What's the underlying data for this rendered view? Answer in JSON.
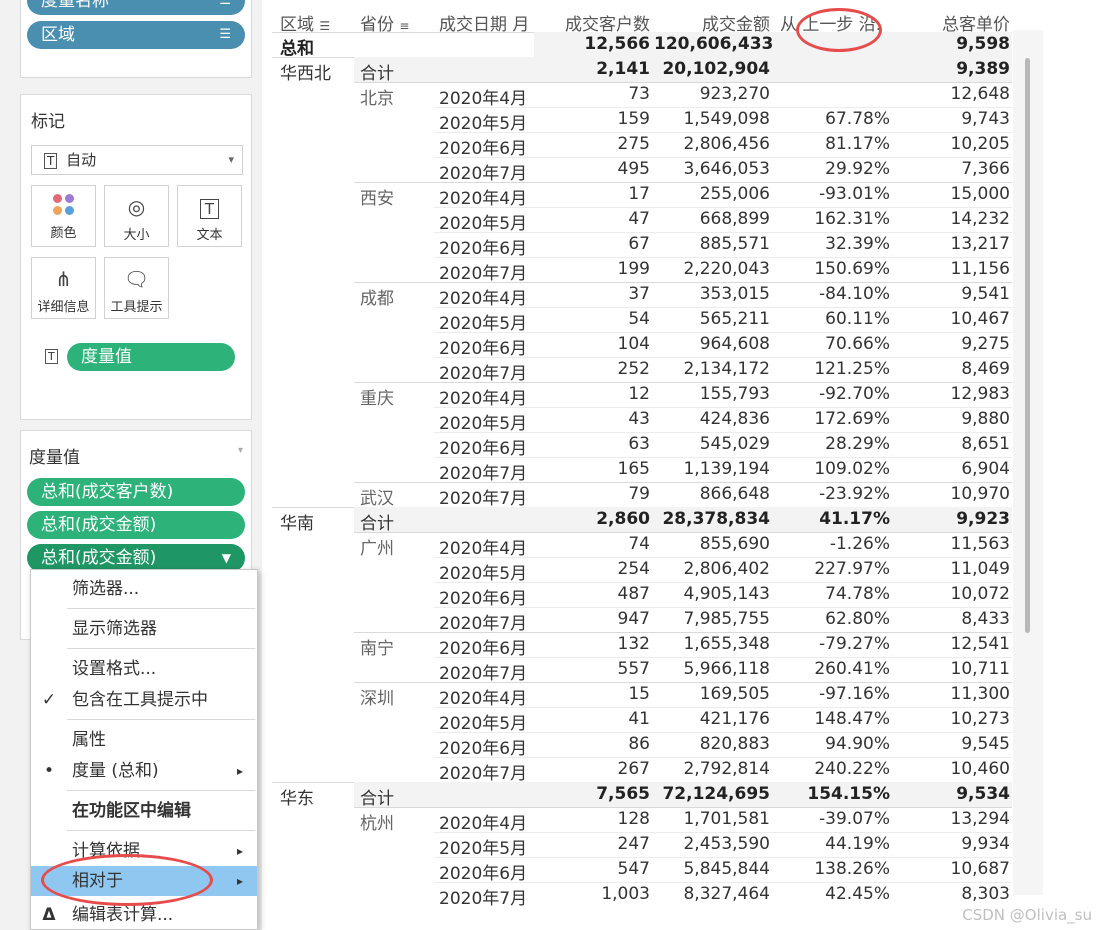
{
  "shelf_pills": {
    "pill1": "度量名称",
    "pill2": "区域"
  },
  "marks": {
    "title": "标记",
    "type_label": "自动",
    "buttons": {
      "color": "颜色",
      "size": "大小",
      "text": "文本",
      "detail": "详细信息",
      "tooltip": "工具提示"
    },
    "measure_pill": "度量值"
  },
  "measure_values": {
    "title": "度量值",
    "pills": [
      "总和(成交客户数)",
      "总和(成交金额)",
      "总和(成交金额)"
    ]
  },
  "menu": {
    "items": {
      "filter": "筛选器...",
      "show_filter": "显示筛选器",
      "format": "设置格式...",
      "include_tooltip": "包含在工具提示中",
      "properties": "属性",
      "measure_sum": "度量 (总和)",
      "edit_shelf": "在功能区中编辑",
      "compute_using": "计算依据",
      "relative_to": "相对于",
      "edit_calc": "编辑表计算..."
    },
    "check_mark": "✓",
    "bullet": "•",
    "delta": "Δ",
    "arrow": "▸"
  },
  "table": {
    "headers": {
      "region": "区域",
      "province": "省份",
      "date": "成交日期 月",
      "customers": "成交客户数",
      "amount": "成交金额",
      "diff": "从 上一步 沿.",
      "unit_price": "总客单价"
    },
    "grand_total": {
      "label": "总和",
      "customers": "12,566",
      "amount": "120,606,433",
      "diff": "",
      "price": "9,598"
    },
    "rows": [
      {
        "region": "华西北",
        "prov": "合计",
        "date": "",
        "cust": "2,141",
        "amt": "20,102,904",
        "diff": "",
        "price": "9,389",
        "sub": true
      },
      {
        "region": "",
        "prov": "北京",
        "date": "2020年4月",
        "cust": "73",
        "amt": "923,270",
        "diff": "",
        "price": "12,648"
      },
      {
        "region": "",
        "prov": "",
        "date": "2020年5月",
        "cust": "159",
        "amt": "1,549,098",
        "diff": "67.78%",
        "price": "9,743"
      },
      {
        "region": "",
        "prov": "",
        "date": "2020年6月",
        "cust": "275",
        "amt": "2,806,456",
        "diff": "81.17%",
        "price": "10,205"
      },
      {
        "region": "",
        "prov": "",
        "date": "2020年7月",
        "cust": "495",
        "amt": "3,646,053",
        "diff": "29.92%",
        "price": "7,366"
      },
      {
        "region": "",
        "prov": "西安",
        "date": "2020年4月",
        "cust": "17",
        "amt": "255,006",
        "diff": "-93.01%",
        "price": "15,000"
      },
      {
        "region": "",
        "prov": "",
        "date": "2020年5月",
        "cust": "47",
        "amt": "668,899",
        "diff": "162.31%",
        "price": "14,232"
      },
      {
        "region": "",
        "prov": "",
        "date": "2020年6月",
        "cust": "67",
        "amt": "885,571",
        "diff": "32.39%",
        "price": "13,217"
      },
      {
        "region": "",
        "prov": "",
        "date": "2020年7月",
        "cust": "199",
        "amt": "2,220,043",
        "diff": "150.69%",
        "price": "11,156"
      },
      {
        "region": "",
        "prov": "成都",
        "date": "2020年4月",
        "cust": "37",
        "amt": "353,015",
        "diff": "-84.10%",
        "price": "9,541"
      },
      {
        "region": "",
        "prov": "",
        "date": "2020年5月",
        "cust": "54",
        "amt": "565,211",
        "diff": "60.11%",
        "price": "10,467"
      },
      {
        "region": "",
        "prov": "",
        "date": "2020年6月",
        "cust": "104",
        "amt": "964,608",
        "diff": "70.66%",
        "price": "9,275"
      },
      {
        "region": "",
        "prov": "",
        "date": "2020年7月",
        "cust": "252",
        "amt": "2,134,172",
        "diff": "121.25%",
        "price": "8,469"
      },
      {
        "region": "",
        "prov": "重庆",
        "date": "2020年4月",
        "cust": "12",
        "amt": "155,793",
        "diff": "-92.70%",
        "price": "12,983"
      },
      {
        "region": "",
        "prov": "",
        "date": "2020年5月",
        "cust": "43",
        "amt": "424,836",
        "diff": "172.69%",
        "price": "9,880"
      },
      {
        "region": "",
        "prov": "",
        "date": "2020年6月",
        "cust": "63",
        "amt": "545,029",
        "diff": "28.29%",
        "price": "8,651"
      },
      {
        "region": "",
        "prov": "",
        "date": "2020年7月",
        "cust": "165",
        "amt": "1,139,194",
        "diff": "109.02%",
        "price": "6,904"
      },
      {
        "region": "",
        "prov": "武汉",
        "date": "2020年7月",
        "cust": "79",
        "amt": "866,648",
        "diff": "-23.92%",
        "price": "10,970"
      },
      {
        "region": "华南",
        "prov": "合计",
        "date": "",
        "cust": "2,860",
        "amt": "28,378,834",
        "diff": "41.17%",
        "price": "9,923",
        "sub": true
      },
      {
        "region": "",
        "prov": "广州",
        "date": "2020年4月",
        "cust": "74",
        "amt": "855,690",
        "diff": "-1.26%",
        "price": "11,563"
      },
      {
        "region": "",
        "prov": "",
        "date": "2020年5月",
        "cust": "254",
        "amt": "2,806,402",
        "diff": "227.97%",
        "price": "11,049"
      },
      {
        "region": "",
        "prov": "",
        "date": "2020年6月",
        "cust": "487",
        "amt": "4,905,143",
        "diff": "74.78%",
        "price": "10,072"
      },
      {
        "region": "",
        "prov": "",
        "date": "2020年7月",
        "cust": "947",
        "amt": "7,985,755",
        "diff": "62.80%",
        "price": "8,433"
      },
      {
        "region": "",
        "prov": "南宁",
        "date": "2020年6月",
        "cust": "132",
        "amt": "1,655,348",
        "diff": "-79.27%",
        "price": "12,541"
      },
      {
        "region": "",
        "prov": "",
        "date": "2020年7月",
        "cust": "557",
        "amt": "5,966,118",
        "diff": "260.41%",
        "price": "10,711"
      },
      {
        "region": "",
        "prov": "深圳",
        "date": "2020年4月",
        "cust": "15",
        "amt": "169,505",
        "diff": "-97.16%",
        "price": "11,300"
      },
      {
        "region": "",
        "prov": "",
        "date": "2020年5月",
        "cust": "41",
        "amt": "421,176",
        "diff": "148.47%",
        "price": "10,273"
      },
      {
        "region": "",
        "prov": "",
        "date": "2020年6月",
        "cust": "86",
        "amt": "820,883",
        "diff": "94.90%",
        "price": "9,545"
      },
      {
        "region": "",
        "prov": "",
        "date": "2020年7月",
        "cust": "267",
        "amt": "2,792,814",
        "diff": "240.22%",
        "price": "10,460"
      },
      {
        "region": "华东",
        "prov": "合计",
        "date": "",
        "cust": "7,565",
        "amt": "72,124,695",
        "diff": "154.15%",
        "price": "9,534",
        "sub": true
      },
      {
        "region": "",
        "prov": "杭州",
        "date": "2020年4月",
        "cust": "128",
        "amt": "1,701,581",
        "diff": "-39.07%",
        "price": "13,294"
      },
      {
        "region": "",
        "prov": "",
        "date": "2020年5月",
        "cust": "247",
        "amt": "2,453,590",
        "diff": "44.19%",
        "price": "9,934"
      },
      {
        "region": "",
        "prov": "",
        "date": "2020年6月",
        "cust": "547",
        "amt": "5,845,844",
        "diff": "138.26%",
        "price": "10,687"
      },
      {
        "region": "",
        "prov": "",
        "date": "2020年7月",
        "cust": "1,003",
        "amt": "8,327,464",
        "diff": "42.45%",
        "price": "8,303"
      }
    ]
  },
  "watermark": "CSDN @Olivia_su",
  "colors": {
    "blue_pill": "#4a8fb0",
    "green_pill": "#2db37a",
    "menu_highlight": "#8fc7f0",
    "annotation_red": "#e74c4c"
  }
}
